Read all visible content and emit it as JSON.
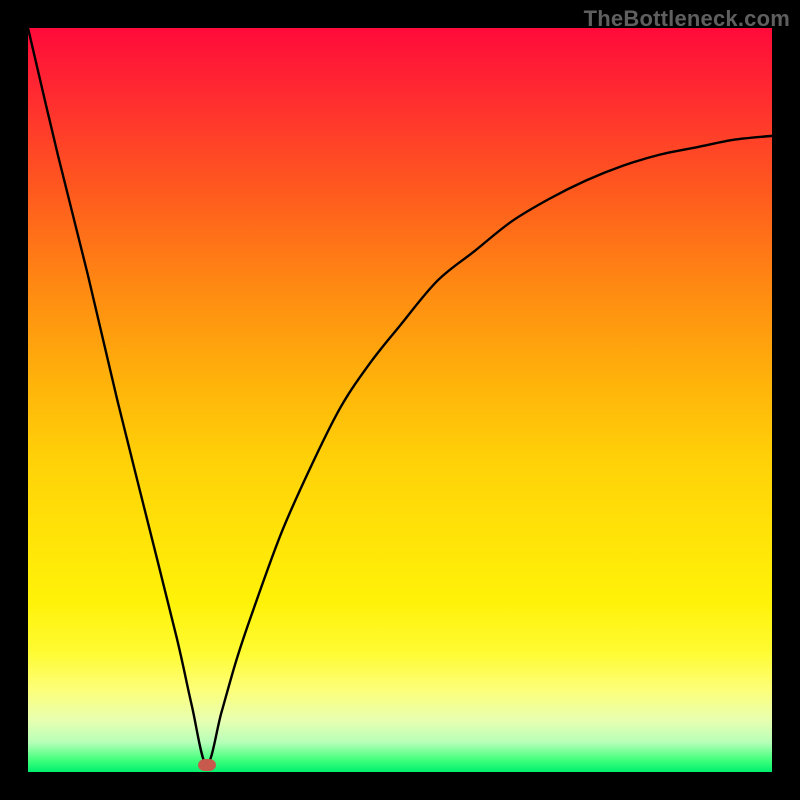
{
  "watermark": "TheBottleneck.com",
  "chart_data": {
    "type": "line",
    "title": "",
    "xlabel": "",
    "ylabel": "",
    "xlim": [
      0,
      100
    ],
    "ylim": [
      0,
      100
    ],
    "grid": false,
    "legend": false,
    "marker": {
      "x": 24,
      "y": 1
    },
    "series": [
      {
        "name": "curve",
        "x": [
          0,
          4,
          8,
          12,
          16,
          20,
          22,
          24,
          26,
          28,
          30,
          34,
          38,
          42,
          46,
          50,
          55,
          60,
          65,
          70,
          75,
          80,
          85,
          90,
          95,
          100
        ],
        "y": [
          100,
          83,
          67,
          50,
          34,
          18,
          9,
          1,
          8,
          15,
          21,
          32,
          41,
          49,
          55,
          60,
          66,
          70,
          74,
          77,
          79.5,
          81.5,
          83,
          84,
          85,
          85.5
        ]
      }
    ],
    "background_gradient": {
      "direction": "vertical",
      "stops": [
        {
          "pos": 0.0,
          "color": "#ff0a3a"
        },
        {
          "pos": 0.1,
          "color": "#ff2f2f"
        },
        {
          "pos": 0.22,
          "color": "#ff5a1e"
        },
        {
          "pos": 0.35,
          "color": "#ff8a12"
        },
        {
          "pos": 0.48,
          "color": "#ffb40a"
        },
        {
          "pos": 0.58,
          "color": "#ffd108"
        },
        {
          "pos": 0.68,
          "color": "#ffe308"
        },
        {
          "pos": 0.77,
          "color": "#fff208"
        },
        {
          "pos": 0.84,
          "color": "#fffb33"
        },
        {
          "pos": 0.89,
          "color": "#fdff7a"
        },
        {
          "pos": 0.93,
          "color": "#e8ffb0"
        },
        {
          "pos": 0.96,
          "color": "#b7ffb8"
        },
        {
          "pos": 0.985,
          "color": "#3cff7a"
        },
        {
          "pos": 1.0,
          "color": "#00f06e"
        }
      ]
    }
  }
}
